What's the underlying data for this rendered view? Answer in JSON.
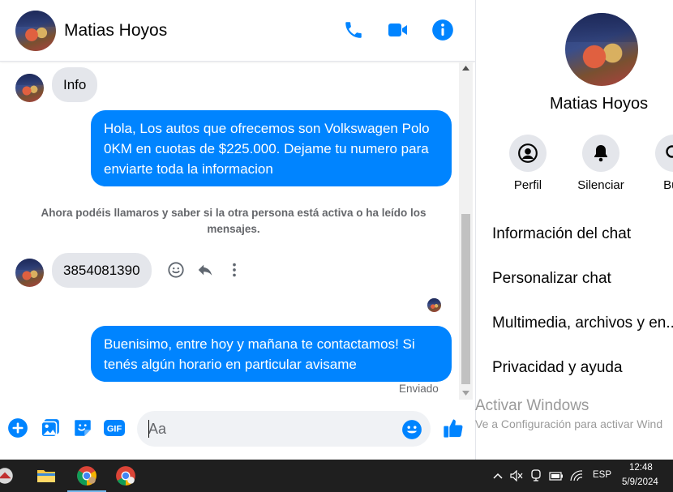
{
  "header": {
    "contact_name": "Matias Hoyos"
  },
  "messages": {
    "info_text": "Info",
    "outgoing_1": "Hola, Los autos que ofrecemos son Volkswagen Polo 0KM en cuotas de $225.000. Dejame tu numero para enviarte toda la informacion",
    "system_note": "Ahora podéis llamaros y saber si la otra persona está activa o ha leído los mensajes.",
    "incoming_phone": "3854081390",
    "outgoing_2": "Buenisimo, entre hoy y mañana te contactamos! Si tenés algún horario en particular avisame",
    "status": "Enviado"
  },
  "composer": {
    "placeholder": "Aa",
    "gif_label": "GIF"
  },
  "panel": {
    "contact_name": "Matias Hoyos",
    "actions": [
      {
        "label": "Perfil",
        "icon": "profile-icon"
      },
      {
        "label": "Silenciar",
        "icon": "bell-icon"
      },
      {
        "label": "Bus",
        "icon": "search-icon"
      }
    ],
    "menu": [
      "Información del chat",
      "Personalizar chat",
      "Multimedia, archivos y en...",
      "Privacidad y ayuda"
    ]
  },
  "watermark": {
    "title": "Activar Windows",
    "subtitle": "Ve a Configuración para activar Wind"
  },
  "taskbar": {
    "language": "ESP",
    "time": "12:48",
    "date": "5/9/2024"
  },
  "colors": {
    "accent": "#0084ff",
    "bubble_in": "#e4e6eb",
    "taskbar": "#1f1f1f"
  }
}
